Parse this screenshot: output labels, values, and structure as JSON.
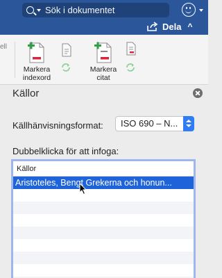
{
  "topbar": {
    "search_placeholder": "Sök i dokumentet",
    "share_label": "Dela",
    "collapse_ribbon": "^",
    "colors": {
      "bar": "#2b579a",
      "search_bg": "#1f4379"
    }
  },
  "ribbon": {
    "truncated_label": "ell",
    "mark_index_label_line1": "Markera",
    "mark_index_label_line2": "indexord",
    "mark_citation_label_line1": "Markera",
    "mark_citation_label_line2": "citat"
  },
  "panel": {
    "title": "Källor",
    "format_label": "Källhänvisningsformat:",
    "format_value": "ISO 690 – N...",
    "insert_label": "Dubbelklicka för att infoga:",
    "list": {
      "header": "Källor",
      "rows": [
        {
          "text": "Aristoteles, Bengt Grekerna och honun...",
          "selected": true
        }
      ],
      "empty_rows": 8
    },
    "colors": {
      "accent": "#2f7cf6",
      "selection": "#1e63d9",
      "list_border": "#9db6ee"
    }
  },
  "icons": [
    "search-icon",
    "smiley-feedback-icon",
    "share-icon",
    "mark-index-entry-icon",
    "mark-citation-icon",
    "document-icon",
    "refresh-icon",
    "close-icon",
    "mouse-cursor-icon"
  ]
}
